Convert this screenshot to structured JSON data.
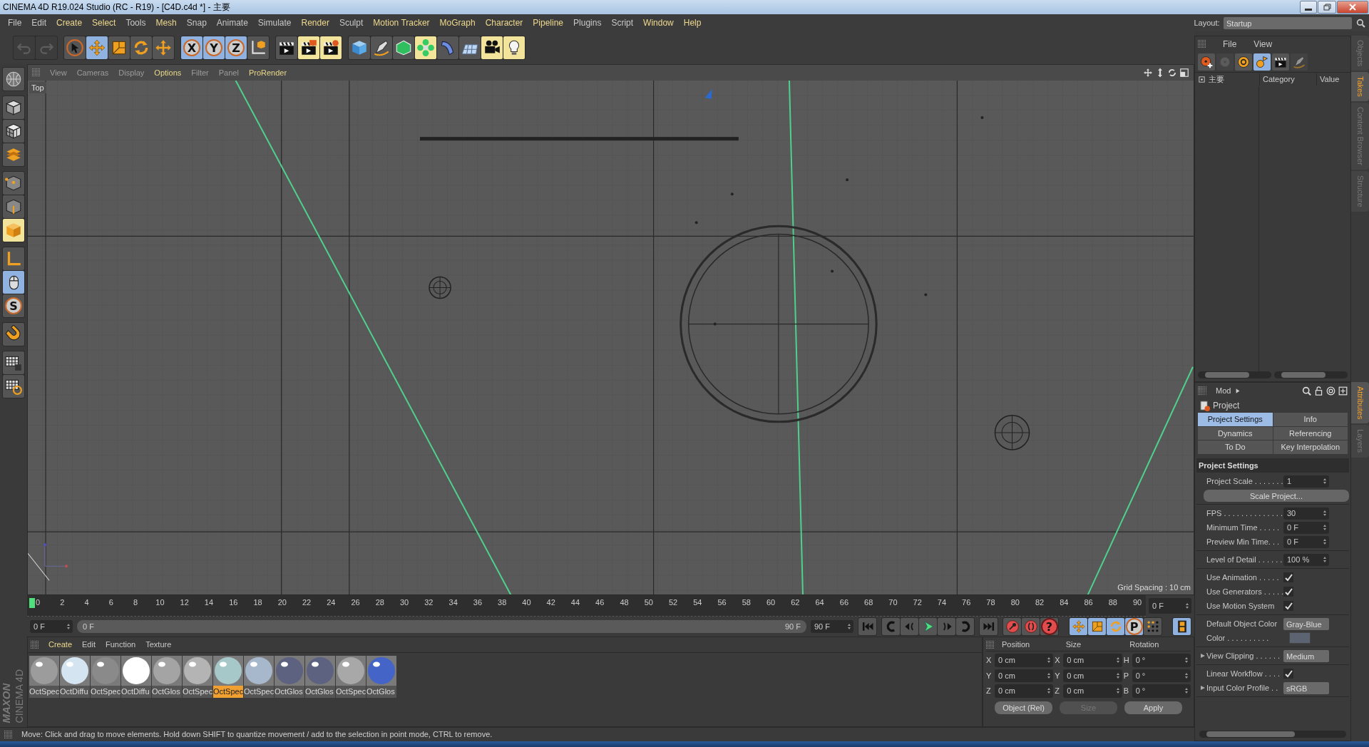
{
  "window": {
    "title": "CINEMA 4D R19.024 Studio (RC - R19) - [C4D.c4d *] - 主要"
  },
  "menu_bar": [
    {
      "label": "File",
      "highlighted": false
    },
    {
      "label": "Edit",
      "highlighted": false
    },
    {
      "label": "Create",
      "highlighted": true
    },
    {
      "label": "Select",
      "highlighted": true
    },
    {
      "label": "Tools",
      "highlighted": false
    },
    {
      "label": "Mesh",
      "highlighted": true
    },
    {
      "label": "Snap",
      "highlighted": false
    },
    {
      "label": "Animate",
      "highlighted": false
    },
    {
      "label": "Simulate",
      "highlighted": false
    },
    {
      "label": "Render",
      "highlighted": true
    },
    {
      "label": "Sculpt",
      "highlighted": false
    },
    {
      "label": "Motion Tracker",
      "highlighted": true
    },
    {
      "label": "MoGraph",
      "highlighted": true
    },
    {
      "label": "Character",
      "highlighted": true
    },
    {
      "label": "Pipeline",
      "highlighted": true
    },
    {
      "label": "Plugins",
      "highlighted": false
    },
    {
      "label": "Script",
      "highlighted": false
    },
    {
      "label": "Window",
      "highlighted": true
    },
    {
      "label": "Help",
      "highlighted": true
    }
  ],
  "layout": {
    "label": "Layout:",
    "value": "Startup"
  },
  "toolbar": [
    [
      {
        "kind": "undo",
        "disabled": true
      },
      {
        "kind": "redo",
        "disabled": true
      }
    ],
    [
      {
        "kind": "cursor",
        "active": false,
        "highlighted": false
      },
      {
        "kind": "move",
        "active": true,
        "highlighted": false
      },
      {
        "kind": "scale",
        "active": false,
        "highlighted": false
      },
      {
        "kind": "rotate",
        "active": false,
        "highlighted": false
      },
      {
        "kind": "transform",
        "active": false,
        "highlighted": false
      }
    ],
    [
      {
        "kind": "axis-letter",
        "label": "X",
        "active": true
      },
      {
        "kind": "axis-letter",
        "label": "Y",
        "active": true
      },
      {
        "kind": "axis-letter",
        "label": "Z",
        "active": true
      },
      {
        "kind": "coords",
        "active": false
      }
    ],
    [
      {
        "kind": "clapper",
        "highlighted": false
      },
      {
        "kind": "clapper-frame",
        "highlighted": true
      },
      {
        "kind": "clapper-gear",
        "highlighted": true
      }
    ],
    [
      {
        "kind": "cube",
        "highlighted": false
      },
      {
        "kind": "pen",
        "highlighted": false
      },
      {
        "kind": "cage-cube",
        "highlighted": false
      },
      {
        "kind": "flower",
        "highlighted": true
      },
      {
        "kind": "bend",
        "highlighted": false
      },
      {
        "kind": "plane",
        "highlighted": false
      },
      {
        "kind": "camera",
        "highlighted": true
      },
      {
        "kind": "bulb",
        "highlighted": true
      }
    ]
  ],
  "tool_palette": [
    [
      {
        "kind": "globe",
        "active": false
      }
    ],
    [
      {
        "kind": "cube-outline"
      },
      {
        "kind": "checker-cube"
      },
      {
        "kind": "layers"
      }
    ],
    [
      {
        "kind": "point-cube",
        "highlighted": false
      },
      {
        "kind": "edge-cube",
        "highlighted": false
      },
      {
        "kind": "poly-cube",
        "highlighted": true
      }
    ],
    [
      {
        "kind": "axis-l",
        "active": false
      },
      {
        "kind": "mouse",
        "active": true
      },
      {
        "kind": "circle-letter",
        "label": "S",
        "active": false
      }
    ],
    [
      {
        "kind": "magnet",
        "active": false
      }
    ],
    [
      {
        "kind": "snap-grid",
        "active": false
      },
      {
        "kind": "snap-lock",
        "active": false
      }
    ]
  ],
  "viewport": {
    "menu": [
      {
        "label": "View",
        "highlighted": false
      },
      {
        "label": "Cameras",
        "highlighted": false
      },
      {
        "label": "Display",
        "highlighted": false
      },
      {
        "label": "Options",
        "highlighted": true
      },
      {
        "label": "Filter",
        "highlighted": false
      },
      {
        "label": "Panel",
        "highlighted": false
      },
      {
        "label": "ProRender",
        "highlighted": true
      }
    ],
    "view_name": "Top",
    "grid_spacing": "Grid Spacing : 10 cm"
  },
  "timeline": {
    "ticks": [
      "0",
      "2",
      "4",
      "6",
      "8",
      "10",
      "12",
      "14",
      "16",
      "18",
      "20",
      "22",
      "24",
      "26",
      "28",
      "30",
      "32",
      "34",
      "36",
      "38",
      "40",
      "42",
      "44",
      "46",
      "48",
      "50",
      "52",
      "54",
      "56",
      "58",
      "60",
      "62",
      "64",
      "66",
      "68",
      "70",
      "72",
      "74",
      "76",
      "78",
      "80",
      "82",
      "84",
      "86",
      "88",
      "90"
    ],
    "current_frame": "0 F"
  },
  "transport": {
    "start_field": "0 F",
    "range_start": "0 F",
    "range_end": "90 F",
    "end_field": "90 F",
    "level": 1,
    "groups": [
      [
        {
          "kind": "skip-start"
        }
      ],
      [
        {
          "kind": "loop-back"
        },
        {
          "kind": "step-back"
        },
        {
          "kind": "play"
        },
        {
          "kind": "step-forward"
        },
        {
          "kind": "loop-forward"
        }
      ],
      [
        {
          "kind": "skip-end"
        }
      ],
      [
        {
          "kind": "key"
        },
        {
          "kind": "autokey"
        },
        {
          "kind": "circle-letter-red",
          "label": "?"
        }
      ],
      [
        {
          "kind": "move",
          "active": true
        },
        {
          "kind": "scale",
          "active": true
        },
        {
          "kind": "rotate",
          "active": true
        },
        {
          "kind": "circle-letter",
          "label": "P",
          "active": true
        },
        {
          "kind": "dot-grid",
          "active": false
        }
      ],
      [
        {
          "kind": "film",
          "active": true
        }
      ]
    ]
  },
  "material_manager": {
    "menu": [
      {
        "label": "Create",
        "highlighted": true
      },
      {
        "label": "Edit",
        "highlighted": false
      },
      {
        "label": "Function",
        "highlighted": false
      },
      {
        "label": "Texture",
        "highlighted": false
      }
    ],
    "materials": [
      {
        "label": "OctSpec",
        "color": "#9c9c9c",
        "selected": false
      },
      {
        "label": "OctDiffu",
        "color": "#d4e4f0",
        "selected": false
      },
      {
        "label": "OctSpec",
        "color": "#8a8a8a",
        "selected": false
      },
      {
        "label": "OctDiffu",
        "color": "#ffffff",
        "selected": false
      },
      {
        "label": "OctGlos",
        "color": "#a4a4a4",
        "selected": false
      },
      {
        "label": "OctSpec",
        "color": "#b4b4b4",
        "selected": false
      },
      {
        "label": "OctSpec",
        "color": "#a6c8c8",
        "selected": true
      },
      {
        "label": "OctSpec",
        "color": "#a8b8cc",
        "selected": false
      },
      {
        "label": "OctGlos",
        "color": "#5c6280",
        "selected": false
      },
      {
        "label": "OctGlos",
        "color": "#5c6280",
        "selected": false
      },
      {
        "label": "OctSpec",
        "color": "#a8a8a8",
        "selected": false
      },
      {
        "label": "OctGlos",
        "color": "#4464c8",
        "selected": false
      }
    ]
  },
  "brand": [
    "MAXON",
    "CINEMA 4D"
  ],
  "coordinates": {
    "headers": [
      "Position",
      "Size",
      "Rotation"
    ],
    "rows": [
      {
        "axis": "X",
        "position": "0 cm",
        "size_axis": "X",
        "size": "0 cm",
        "rotation_axis": "H",
        "rotation": "0 °"
      },
      {
        "axis": "Y",
        "position": "0 cm",
        "size_axis": "Y",
        "size": "0 cm",
        "rotation_axis": "P",
        "rotation": "0 °"
      },
      {
        "axis": "Z",
        "position": "0 cm",
        "size_axis": "Z",
        "size": "0 cm",
        "rotation_axis": "B",
        "rotation": "0 °"
      }
    ],
    "mode": "Object (Rel)",
    "size_mode": {
      "label": "Size",
      "disabled": true
    },
    "apply": "Apply"
  },
  "status_bar": "Move: Click and drag to move elements. Hold down SHIFT to quantize movement / add to the selection in point mode, CTRL to remove.",
  "objects_manager": {
    "menu": [
      "File",
      "View"
    ],
    "tools": [
      {
        "kind": "reel-plus",
        "active": false,
        "disabled": false
      },
      {
        "kind": "reel",
        "active": false,
        "disabled": true
      },
      {
        "kind": "target",
        "active": false,
        "disabled": false
      },
      {
        "kind": "shapes",
        "active": true,
        "disabled": false
      },
      {
        "kind": "clapper",
        "active": false,
        "disabled": false
      },
      {
        "kind": "pen",
        "active": false,
        "disabled": true
      }
    ],
    "tree": [
      {
        "label": "主要"
      }
    ],
    "columns": [
      "Category",
      "Value"
    ]
  },
  "side_tabs_top": [
    {
      "label": "Objects",
      "selected": false
    },
    {
      "label": "Takes",
      "selected": true
    },
    {
      "label": "Content Browser",
      "selected": false
    },
    {
      "label": "Structure",
      "selected": false
    }
  ],
  "attributes": {
    "mode": "Mod",
    "object": "Project",
    "tabs": [
      {
        "label": "Project Settings",
        "selected": true
      },
      {
        "label": "Info",
        "selected": false
      },
      {
        "label": "Dynamics",
        "selected": false
      },
      {
        "label": "Referencing",
        "selected": false
      },
      {
        "label": "To Do",
        "selected": false
      },
      {
        "label": "Key Interpolation",
        "selected": false
      }
    ],
    "section": "Project Settings",
    "groups": [
      [
        {
          "kind": "field",
          "label": "Project Scale . . . . . . .",
          "value": "1"
        },
        {
          "kind": "button",
          "value": "Scale Project..."
        }
      ],
      [
        {
          "kind": "field",
          "label": "FPS . . . . . . . . . . . . . .",
          "value": "30"
        },
        {
          "kind": "field",
          "label": "Minimum Time . . . . .",
          "value": "0 F"
        },
        {
          "kind": "field",
          "label": "Preview Min Time. . .",
          "value": "0 F"
        }
      ],
      [
        {
          "kind": "field",
          "label": "Level of Detail . . . . . .",
          "value": "100 %"
        }
      ],
      [
        {
          "kind": "checkbox",
          "label": "Use Animation . . . . .",
          "checked": true
        },
        {
          "kind": "checkbox",
          "label": "Use Generators . . . . .",
          "checked": true
        },
        {
          "kind": "checkbox",
          "label": "Use Motion System",
          "checked": true
        }
      ],
      [
        {
          "kind": "dropdown",
          "label": "Default Object Color",
          "value": "Gray-Blue"
        },
        {
          "kind": "color",
          "label": "Color . . . . . . . . . .",
          "color": "#5b6470"
        }
      ],
      [
        {
          "kind": "dropdown",
          "label": "View Clipping . . . . . .",
          "value": "Medium",
          "expandable": true
        }
      ],
      [
        {
          "kind": "checkbox",
          "label": "Linear Workflow . . . .",
          "checked": true
        },
        {
          "kind": "dropdown",
          "label": "Input Color Profile . .",
          "value": "sRGB",
          "expandable": true
        }
      ]
    ]
  },
  "side_tabs_bottom": [
    {
      "label": "Attributes",
      "selected": true
    },
    {
      "label": "Layers",
      "selected": false
    }
  ]
}
